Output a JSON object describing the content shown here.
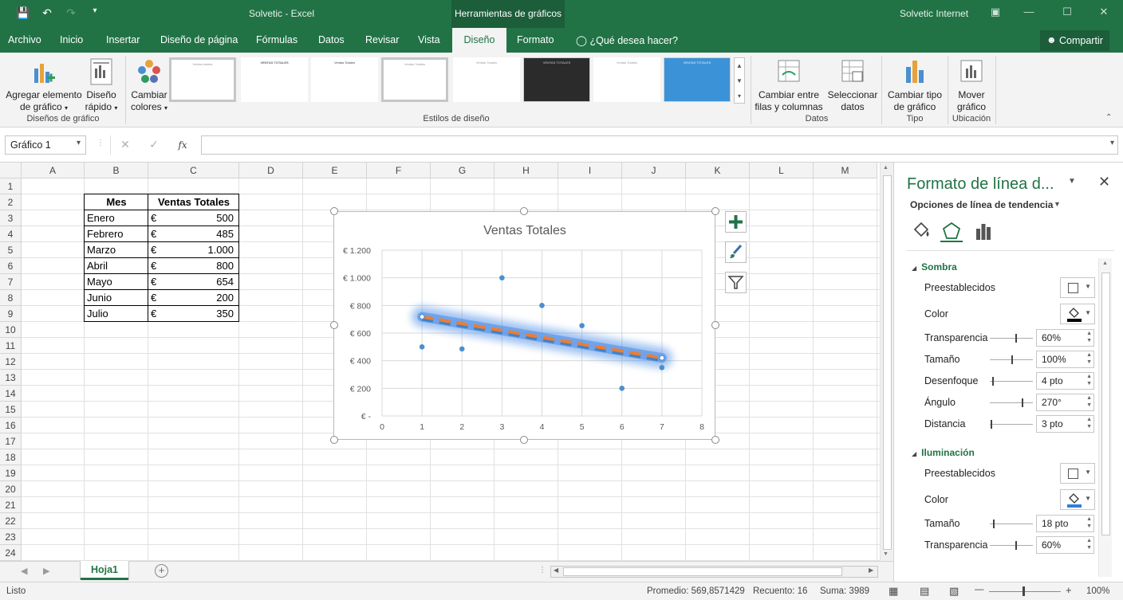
{
  "window": {
    "doc_title": "Solvetic  -  Excel",
    "context_title": "Herramientas de gráficos",
    "user": "Solvetic Internet"
  },
  "tabs": [
    "Archivo",
    "Inicio",
    "Insertar",
    "Diseño de página",
    "Fórmulas",
    "Datos",
    "Revisar",
    "Vista",
    "Diseño",
    "Formato"
  ],
  "tell_me": "¿Qué desea hacer?",
  "share_label": "Compartir",
  "ribbon": {
    "add_element": [
      "Agregar elemento",
      "de gráfico"
    ],
    "quick_layout": [
      "Diseño",
      "rápido"
    ],
    "change_colors": [
      "Cambiar",
      "colores"
    ],
    "group_layouts": "Diseños de gráfico",
    "group_styles": "Estilos de diseño",
    "switch_rowcol": [
      "Cambiar entre",
      "filas y columnas"
    ],
    "select_data": [
      "Seleccionar",
      "datos"
    ],
    "group_data": "Datos",
    "change_type": [
      "Cambiar tipo",
      "de gráfico"
    ],
    "group_type": "Tipo",
    "move_chart": [
      "Mover",
      "gráfico"
    ],
    "group_location": "Ubicación",
    "thumb_titles": [
      "Ventas totales",
      "VENTAS TOTALES",
      "Ventas Totales",
      "Ventas Totales",
      "Ventas Totales",
      "VENTAS TOTALES",
      "Ventas Totales",
      "VENTAS TOTALES"
    ]
  },
  "formula_bar": {
    "name_box": "Gráfico 1",
    "fx": "fx",
    "value": ""
  },
  "columns": [
    "A",
    "B",
    "C",
    "D",
    "E",
    "F",
    "G",
    "H",
    "I",
    "J",
    "K",
    "L",
    "M"
  ],
  "rows": [
    "1",
    "2",
    "3",
    "4",
    "5",
    "6",
    "7",
    "8",
    "9",
    "10",
    "11",
    "12",
    "13",
    "14",
    "15",
    "16",
    "17",
    "18",
    "19",
    "20",
    "21",
    "22",
    "23",
    "24"
  ],
  "table": {
    "headers": [
      "Mes",
      "Ventas Totales"
    ],
    "currency": "€",
    "rows": [
      {
        "month": "Enero",
        "value": "500"
      },
      {
        "month": "Febrero",
        "value": "485"
      },
      {
        "month": "Marzo",
        "value": "1.000"
      },
      {
        "month": "Abril",
        "value": "800"
      },
      {
        "month": "Mayo",
        "value": "654"
      },
      {
        "month": "Junio",
        "value": "200"
      },
      {
        "month": "Julio",
        "value": "350"
      }
    ]
  },
  "chart_data": {
    "type": "scatter",
    "title": "Ventas Totales",
    "x": [
      1,
      2,
      3,
      4,
      5,
      6,
      7
    ],
    "y": [
      500,
      485,
      1000,
      800,
      654,
      200,
      350
    ],
    "xlim": [
      0,
      8
    ],
    "ylim": [
      0,
      1200
    ],
    "x_ticks": [
      "0",
      "1",
      "2",
      "3",
      "4",
      "5",
      "6",
      "7",
      "8"
    ],
    "y_ticks": [
      "€ -",
      "€ 200",
      "€ 400",
      "€ 600",
      "€ 800",
      "€ 1.000",
      "€ 1.200"
    ],
    "trendline": {
      "type": "linear",
      "x": [
        1,
        7
      ],
      "y": [
        718,
        420
      ],
      "style": "dashed",
      "color": "#ed7d31",
      "glow_color": "#4f8fe6"
    },
    "grid": true,
    "point_color": "#4a8fd0"
  },
  "sheet": {
    "tab": "Hoja1"
  },
  "status": {
    "ready": "Listo",
    "average": "Promedio: 569,8571429",
    "count": "Recuento: 16",
    "sum": "Suma: 3989",
    "zoom": "100%"
  },
  "pane": {
    "title": "Formato de línea d...",
    "subtitle": "Opciones de línea de tendencia",
    "shadow": {
      "label": "Sombra",
      "presets": "Preestablecidos",
      "color": "Color",
      "transparency": "Transparencia",
      "transparency_value": "60%",
      "size": "Tamaño",
      "size_value": "100%",
      "blur": "Desenfoque",
      "blur_value": "4 pto",
      "angle": "Ángulo",
      "angle_value": "270°",
      "distance": "Distancia",
      "distance_value": "3 pto"
    },
    "glow": {
      "label": "Iluminación",
      "presets": "Preestablecidos",
      "color": "Color",
      "size": "Tamaño",
      "size_value": "18 pto",
      "transparency": "Transparencia",
      "transparency_value": "60%"
    }
  }
}
